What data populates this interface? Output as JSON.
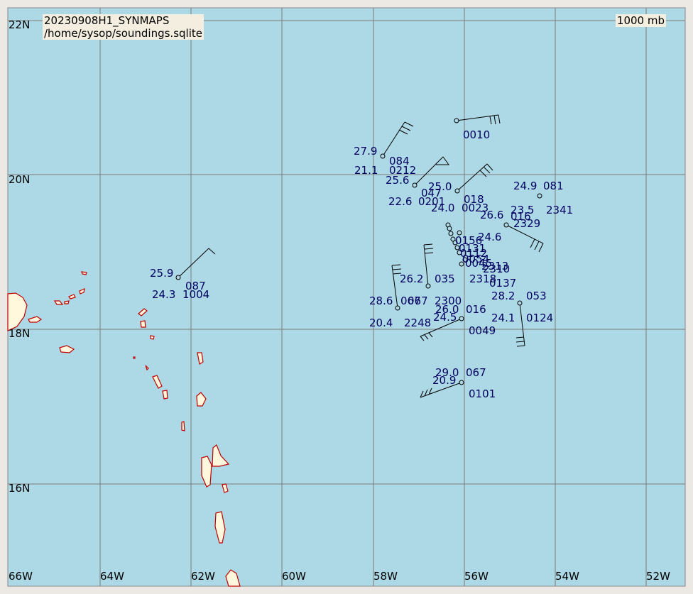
{
  "header": {
    "title": "20230908H1_SYNMAPS",
    "path": "/home/sysop/soundings.sqlite",
    "level": "1000 mb"
  },
  "colors": {
    "ocean": "#add8e6",
    "land": "#fff8dc",
    "coast": "#c00000",
    "grid": "#7a7a7a",
    "label": "#000060",
    "frame": "#ece9e4"
  },
  "axes": {
    "lat_labels": [
      "22N",
      "20N",
      "18N",
      "16N"
    ],
    "lon_labels": [
      "66W",
      "64W",
      "62W",
      "60W",
      "58W",
      "56W",
      "54W",
      "52W"
    ]
  },
  "stations": [
    {
      "temp": "27.9",
      "dew": "21.1",
      "dir": "084",
      "time": "0212"
    },
    {
      "temp": "",
      "dew": "",
      "dir": "",
      "time": "0010"
    },
    {
      "temp": "25.6",
      "dew": "22.6",
      "dir": "047",
      "time": "0201"
    },
    {
      "temp": "25.0",
      "dew": "24.0",
      "dir": "018",
      "time": "0023"
    },
    {
      "temp": "24.9",
      "dew": "23.5",
      "dir": "081",
      "time": "2341"
    },
    {
      "temp": "26.6",
      "dew": "24.6",
      "dir": "016",
      "time": "2329"
    },
    {
      "temp": "25.9",
      "dew": "24.3",
      "dir": "087",
      "time": "1004"
    },
    {
      "temp": "26.2",
      "dew": "",
      "dir": "035",
      "time": ""
    },
    {
      "temp": "28.6",
      "dew": "20.4",
      "dir": "067",
      "time": "2248"
    },
    {
      "temp": "26.0",
      "dew": "24.5",
      "dir": "016",
      "time": "0049"
    },
    {
      "temp": "2300",
      "dew": "",
      "dir": "",
      "time": ""
    },
    {
      "temp": "28.2",
      "dew": "24.1",
      "dir": "053",
      "time": "0124"
    },
    {
      "temp": "29.0",
      "dew": "20.9",
      "dir": "067",
      "time": "0101"
    },
    {
      "temp": "",
      "dew": "",
      "dir": "0137",
      "time": "2318"
    }
  ],
  "cluster_labels": [
    "0156",
    "0131",
    "0112",
    "0054",
    "0045",
    "2313",
    "2310"
  ]
}
